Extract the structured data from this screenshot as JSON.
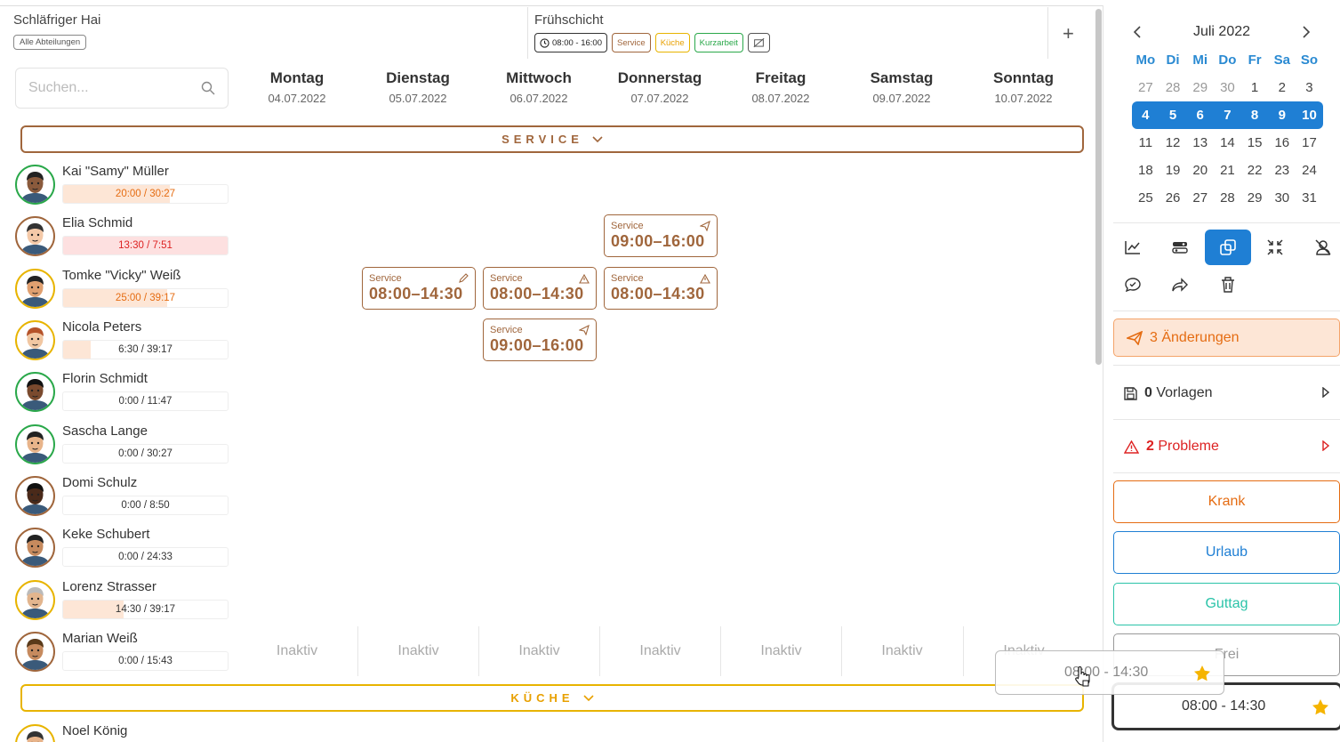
{
  "header": {
    "team_name": "Schläfriger Hai",
    "department_filter": "Alle Abteilungen",
    "shift_template": {
      "name": "Frühschicht",
      "time": "08:00 - 16:00",
      "tags": [
        "Service",
        "Küche",
        "Kurzarbeit"
      ]
    },
    "add_symbol": "+"
  },
  "search": {
    "placeholder": "Suchen..."
  },
  "days": [
    {
      "name": "Montag",
      "date": "04.07.2022"
    },
    {
      "name": "Dienstag",
      "date": "05.07.2022"
    },
    {
      "name": "Mittwoch",
      "date": "06.07.2022"
    },
    {
      "name": "Donnerstag",
      "date": "07.07.2022"
    },
    {
      "name": "Freitag",
      "date": "08.07.2022"
    },
    {
      "name": "Samstag",
      "date": "09.07.2022"
    },
    {
      "name": "Sonntag",
      "date": "10.07.2022"
    }
  ],
  "groups": {
    "service": "SERVICE",
    "kueche": "KÜCHE"
  },
  "employees": [
    {
      "name": "Kai \"Samy\" Müller",
      "hours": "20:00 / 30:27",
      "ratio": 0.65,
      "bar": "#fde6d6",
      "text_color": "#e56c12",
      "ring": "#2aa84a"
    },
    {
      "name": "Elia Schmid",
      "hours": "13:30 / 7:51",
      "ratio": 1.0,
      "bar": "#fde0e0",
      "text_color": "#d22",
      "ring": "#a0663c"
    },
    {
      "name": "Tomke \"Vicky\" Weiß",
      "hours": "25:00 / 39:17",
      "ratio": 0.63,
      "bar": "#fde6d6",
      "text_color": "#e56c12",
      "ring": "#e8b400"
    },
    {
      "name": "Nicola Peters",
      "hours": "6:30 / 39:17",
      "ratio": 0.17,
      "bar": "#fde6d6",
      "text_color": "#333",
      "ring": "#e8b400"
    },
    {
      "name": "Florin Schmidt",
      "hours": "0:00 / 11:47",
      "ratio": 0,
      "bar": "#fde6d6",
      "text_color": "#333",
      "ring": "#2aa84a"
    },
    {
      "name": "Sascha Lange",
      "hours": "0:00 / 30:27",
      "ratio": 0,
      "bar": "#fde6d6",
      "text_color": "#333",
      "ring": "#2aa84a"
    },
    {
      "name": "Domi Schulz",
      "hours": "0:00 / 8:50",
      "ratio": 0,
      "bar": "#fde6d6",
      "text_color": "#333",
      "ring": "#a0663c"
    },
    {
      "name": "Keke Schubert",
      "hours": "0:00 / 24:33",
      "ratio": 0,
      "bar": "#fde6d6",
      "text_color": "#333",
      "ring": "#a0663c"
    },
    {
      "name": "Lorenz Strasser",
      "hours": "14:30 / 39:17",
      "ratio": 0.37,
      "bar": "#fde6d6",
      "text_color": "#333",
      "ring": "#e8b400"
    },
    {
      "name": "Marian Weiß",
      "hours": "0:00 / 15:43",
      "ratio": 0,
      "bar": "#fde6d6",
      "text_color": "#333",
      "ring": "#a0663c"
    },
    {
      "name": "Noel König",
      "hours": "",
      "ratio": 0,
      "bar": "#fde6d6",
      "text_color": "#333",
      "ring": "#e8b400"
    }
  ],
  "shifts": [
    {
      "label": "Service",
      "time": "09:00–16:00",
      "icon": "send-icon"
    },
    {
      "label": "Service",
      "time": "08:00–14:30",
      "icon": "pencil-icon"
    },
    {
      "label": "Service",
      "time": "08:00–14:30",
      "icon": "warning-icon"
    },
    {
      "label": "Service",
      "time": "08:00–14:30",
      "icon": "warning-icon"
    },
    {
      "label": "Service",
      "time": "09:00–16:00",
      "icon": "send-icon"
    }
  ],
  "inactive_label": "Inaktiv",
  "calendar": {
    "month": "Juli 2022",
    "weekdays": [
      "Mo",
      "Di",
      "Mi",
      "Do",
      "Fr",
      "Sa",
      "So"
    ],
    "days": [
      "27",
      "28",
      "29",
      "30",
      "1",
      "2",
      "3",
      "4",
      "5",
      "6",
      "7",
      "8",
      "9",
      "10",
      "11",
      "12",
      "13",
      "14",
      "15",
      "16",
      "17",
      "18",
      "19",
      "20",
      "21",
      "22",
      "23",
      "24",
      "25",
      "26",
      "27",
      "28",
      "29",
      "30",
      "31"
    ]
  },
  "panel": {
    "changes_count": "3",
    "changes_label": "Änderungen",
    "templates_count": "0",
    "templates_label": "Vorlagen",
    "problems_count": "2",
    "problems_label": "Probleme",
    "absences": [
      {
        "label": "Krank",
        "color": "#e56c12"
      },
      {
        "label": "Urlaub",
        "color": "#1f7fd4"
      },
      {
        "label": "Guttag",
        "color": "#2ac3a8"
      },
      {
        "label": "Frei",
        "color": "#999999"
      }
    ],
    "time_preset": "08:00 - 14:30"
  },
  "colors": {
    "accent": "#1f7fd4",
    "service": "#a0663c",
    "kueche": "#e8b400",
    "warning": "#d22",
    "change": "#e56c12"
  }
}
